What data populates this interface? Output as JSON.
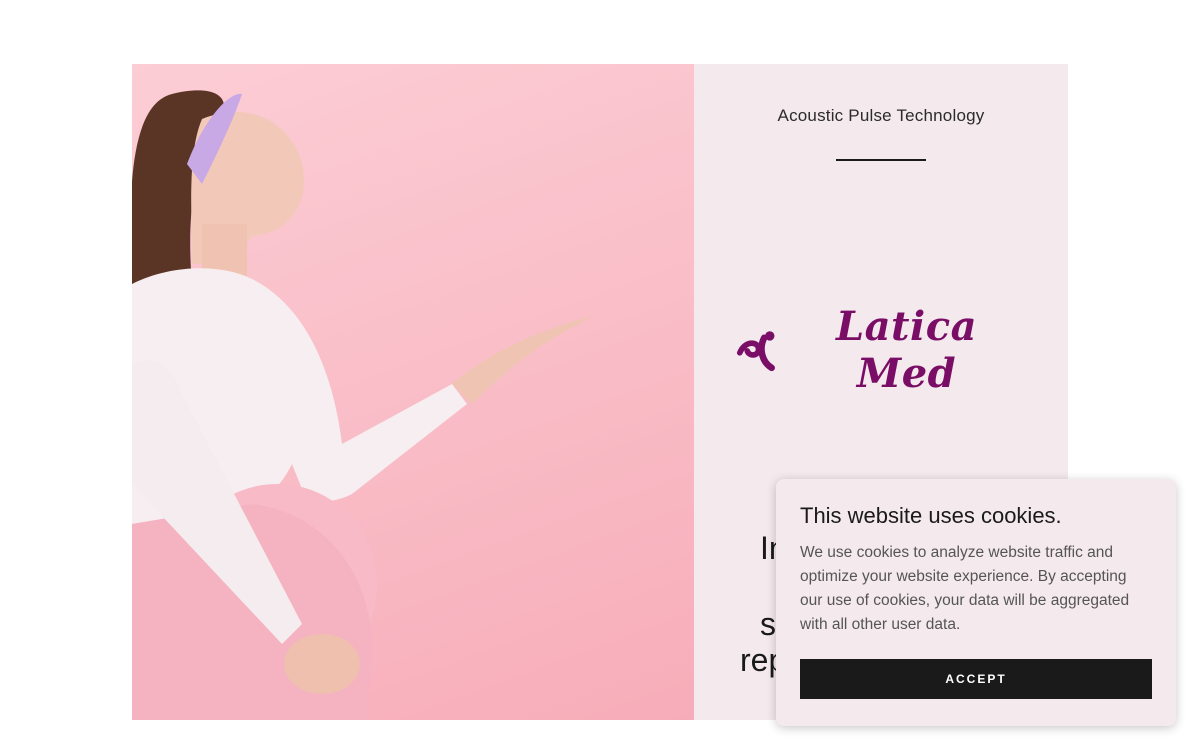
{
  "hero": {
    "image_alt": "pregnant woman in pink presenting with open hand",
    "subtitle": "Acoustic Pulse Technology",
    "logo_text": "Latica Med",
    "partial_lines": [
      "In",
      "st",
      "rep"
    ]
  },
  "cookie_banner": {
    "title": "This website uses cookies.",
    "body": "We use cookies to analyze website traffic and optimize your website experience. By accepting our use of cookies, your data will be aggregated with all other user data.",
    "accept_label": "ACCEPT"
  },
  "colors": {
    "brand": "#7a0e67",
    "panel_bg": "#f4e9ed",
    "photo_bg": "#f9bcc6",
    "button_bg": "#1a1a1a"
  }
}
